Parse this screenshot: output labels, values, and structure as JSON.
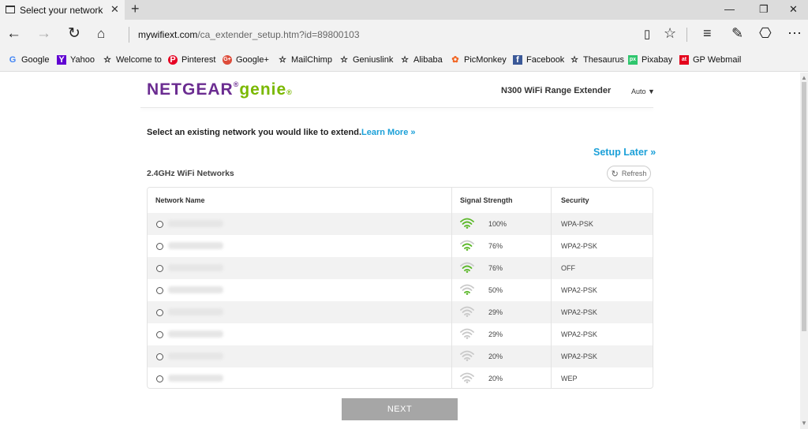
{
  "browser": {
    "tab_title": "Select your network",
    "new_tab": "+",
    "url_domain": "mywifiext.com",
    "url_path": "/ca_extender_setup.htm?id=89800103"
  },
  "favorites": [
    {
      "label": "Google",
      "icon": "G",
      "color": "#4285f4"
    },
    {
      "label": "Yahoo",
      "icon": "Y",
      "color": "#6001d2"
    },
    {
      "label": "Welcome to",
      "icon": "☆",
      "color": "#333333"
    },
    {
      "label": "Pinterest",
      "icon": "P",
      "color": "#e60023"
    },
    {
      "label": "Google+",
      "icon": "G+",
      "color": "#dd4b39"
    },
    {
      "label": "MailChimp",
      "icon": "☆",
      "color": "#333333"
    },
    {
      "label": "Geniuslink",
      "icon": "☆",
      "color": "#333333"
    },
    {
      "label": "Alibaba",
      "icon": "☆",
      "color": "#333333"
    },
    {
      "label": "PicMonkey",
      "icon": "✿",
      "color": "#f26522"
    },
    {
      "label": "Facebook",
      "icon": "f",
      "color": "#3b5998"
    },
    {
      "label": "Thesaurus",
      "icon": "☆",
      "color": "#333333"
    },
    {
      "label": "Pixabay",
      "icon": "px",
      "color": "#2ec66d"
    },
    {
      "label": "GP Webmail",
      "icon": "at",
      "color": "#e4001b"
    }
  ],
  "page": {
    "brand": "NETGEAR",
    "brand_suffix": "genie",
    "product": "N300 WiFi Range Extender",
    "language": "Auto",
    "prompt": "Select an existing network you would like to extend.",
    "learn_more": "Learn More »",
    "setup_later": "Setup Later »",
    "section_title": "2.4GHz WiFi Networks",
    "refresh_label": "Refresh",
    "next_label": "NEXT",
    "columns": [
      "Network Name",
      "Signal Strength",
      "Security"
    ]
  },
  "networks": [
    {
      "signal": "100%",
      "security": "WPA-PSK",
      "strength": 1.0
    },
    {
      "signal": "76%",
      "security": "WPA2-PSK",
      "strength": 0.76
    },
    {
      "signal": "76%",
      "security": "OFF",
      "strength": 0.76
    },
    {
      "signal": "50%",
      "security": "WPA2-PSK",
      "strength": 0.5
    },
    {
      "signal": "29%",
      "security": "WPA2-PSK",
      "strength": 0.29
    },
    {
      "signal": "29%",
      "security": "WPA2-PSK",
      "strength": 0.29
    },
    {
      "signal": "20%",
      "security": "WPA2-PSK",
      "strength": 0.2
    },
    {
      "signal": "20%",
      "security": "WEP",
      "strength": 0.2
    }
  ],
  "colors": {
    "accent": "#1ba0d8",
    "brand": "#6b2c91",
    "genie": "#7ab800",
    "signal": "#5cb82a"
  }
}
